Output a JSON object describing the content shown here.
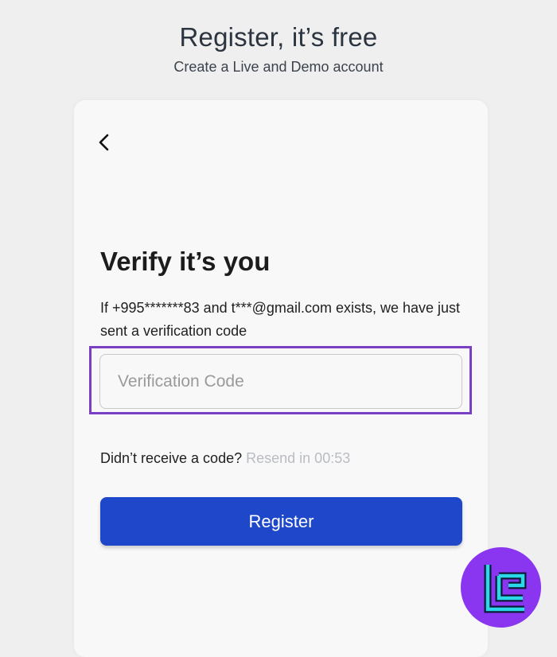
{
  "header": {
    "title": "Register, it’s free",
    "subtitle": "Create a Live and Demo account"
  },
  "card": {
    "back_icon": "chevron-left-icon",
    "heading": "Verify it’s you",
    "info_text": "If +995*******83 and t***@gmail.com exists, we have just sent a verification code",
    "code_input": {
      "placeholder": "Verification Code",
      "value": ""
    },
    "resend": {
      "prompt": "Didn’t receive a code?",
      "link": "Resend in 00:53"
    },
    "register_label": "Register"
  },
  "colors": {
    "primary_button": "#1f47c9",
    "highlight_border": "#7b3fc4",
    "logo_background": "#8a35f0",
    "logo_mark": "#2ad8e8",
    "muted_link": "#b9bcc2"
  },
  "watermark": {
    "icon": "brand-logo-icon"
  }
}
